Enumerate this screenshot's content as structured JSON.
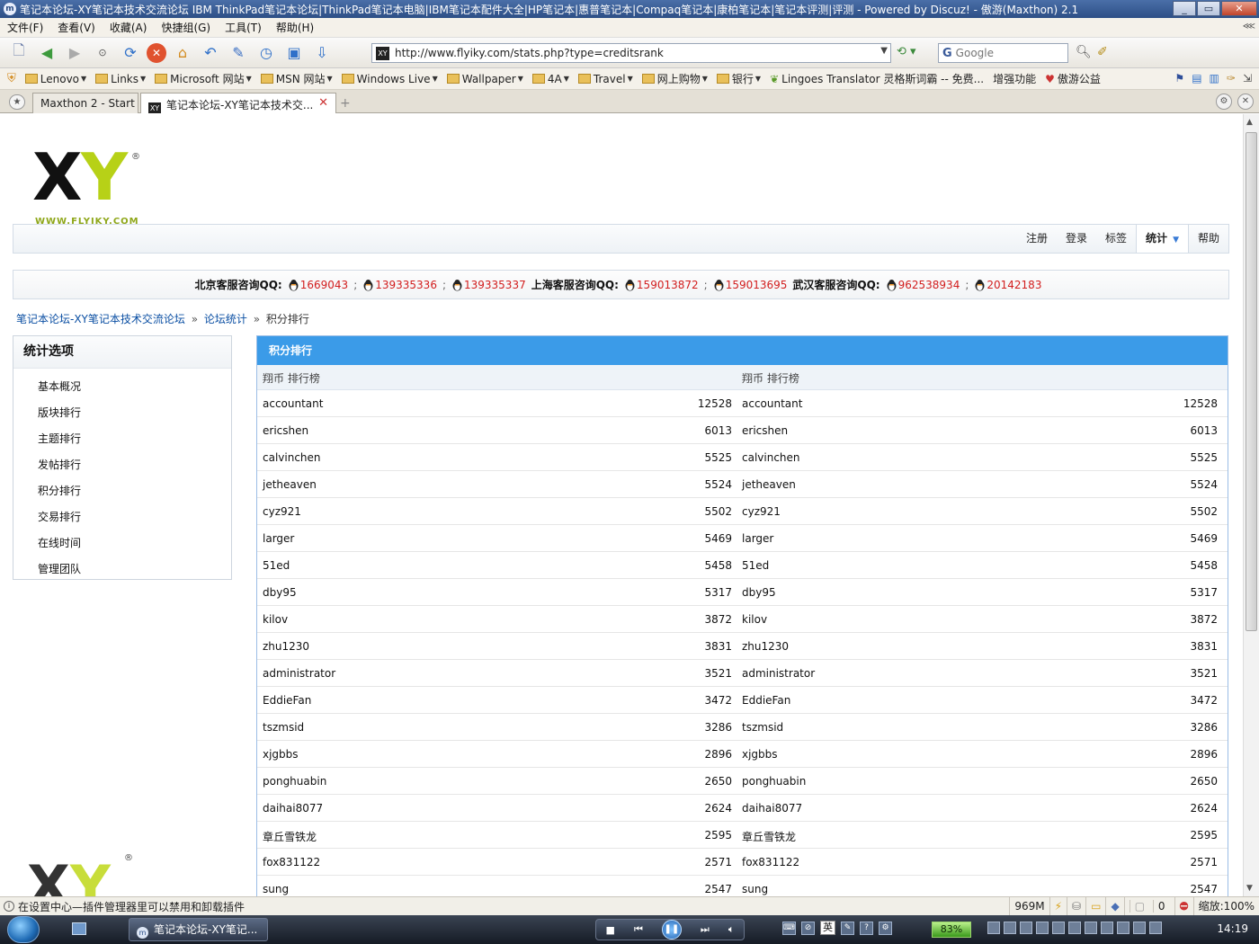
{
  "window": {
    "title": "笔记本论坛-XY笔记本技术交流论坛 IBM ThinkPad笔记本论坛|ThinkPad笔记本电脑|IBM笔记本配件大全|HP笔记本|惠普笔记本|Compaq笔记本|康柏笔记本|笔记本评测|评测 - Powered by Discuz! - 傲游(Maxthon) 2.1",
    "app_icon_glyph": "m"
  },
  "menubar": {
    "items": [
      "文件(F)",
      "查看(V)",
      "收藏(A)",
      "快捷组(G)",
      "工具(T)",
      "帮助(H)"
    ]
  },
  "toolbar": {
    "address": "http://www.flyiky.com/stats.php?type=creditsrank",
    "search_placeholder": "Google",
    "search_engine_glyph": "G",
    "favicon_glyph": "XY"
  },
  "bookmarks": {
    "items": [
      "Lenovo",
      "Links",
      "Microsoft 网站",
      "MSN 网站",
      "Windows Live",
      "Wallpaper",
      "4A",
      "Travel",
      "网上购物",
      "银行"
    ],
    "translator": "Lingoes Translator 灵格斯词霸 -- 免费...",
    "enhance": "增强功能",
    "aoyou": "傲游公益"
  },
  "tabs": [
    {
      "label": "Maxthon 2 - Start"
    },
    {
      "label": "笔记本论坛-XY笔记本技术交..."
    }
  ],
  "site": {
    "logo_x": "X",
    "logo_y": "Y",
    "logo_reg": "®",
    "logo_url": "WWW.FLYIKY.COM",
    "nav": [
      "注册",
      "登录",
      "标签",
      "统计",
      "帮助"
    ],
    "caret": "▼"
  },
  "qq": {
    "beijing_label": "北京客服咨询QQ:",
    "beijing": [
      "1669043",
      "139335336",
      "139335337"
    ],
    "shanghai_label": "上海客服咨询QQ:",
    "shanghai": [
      "159013872",
      "159013695"
    ],
    "wuhan_label": "武汉客服咨询QQ:",
    "wuhan": [
      "962538934",
      "20142183"
    ]
  },
  "breadcrumb": {
    "home": "笔记本论坛-XY笔记本技术交流论坛",
    "stats": "论坛统计",
    "current": "积分排行",
    "sep": "»"
  },
  "sidebar": {
    "title": "统计选项",
    "items": [
      "基本概况",
      "版块排行",
      "主题排行",
      "发帖排行",
      "积分排行",
      "交易排行",
      "在线时间",
      "管理团队"
    ]
  },
  "panel": {
    "title": "积分排行",
    "col1_header": "翔币 排行榜",
    "col2_header": "翔币 排行榜",
    "rows": [
      {
        "name": "accountant",
        "value": "12528"
      },
      {
        "name": "ericshen",
        "value": "6013"
      },
      {
        "name": "calvinchen",
        "value": "5525"
      },
      {
        "name": "jetheaven",
        "value": "5524"
      },
      {
        "name": "cyz921",
        "value": "5502"
      },
      {
        "name": "larger",
        "value": "5469"
      },
      {
        "name": "51ed",
        "value": "5458"
      },
      {
        "name": "dby95",
        "value": "5317"
      },
      {
        "name": "kilov",
        "value": "3872"
      },
      {
        "name": "zhu1230",
        "value": "3831"
      },
      {
        "name": "administrator",
        "value": "3521"
      },
      {
        "name": "EddieFan",
        "value": "3472"
      },
      {
        "name": "tszmsid",
        "value": "3286"
      },
      {
        "name": "xjgbbs",
        "value": "2896"
      },
      {
        "name": "ponghuabin",
        "value": "2650"
      },
      {
        "name": "daihai8077",
        "value": "2624"
      },
      {
        "name": "章丘雪铁龙",
        "value": "2595"
      },
      {
        "name": "fox831122",
        "value": "2571"
      },
      {
        "name": "sung",
        "value": "2547"
      }
    ]
  },
  "statusbar": {
    "message": "在设置中心—插件管理器里可以禁用和卸载插件",
    "memory": "969M",
    "count": "0",
    "zoom": "缩放:100%"
  },
  "taskbar": {
    "window_button": "笔记本论坛-XY笔记...",
    "ime": "英",
    "battery": "83%",
    "clock": "14:19"
  }
}
